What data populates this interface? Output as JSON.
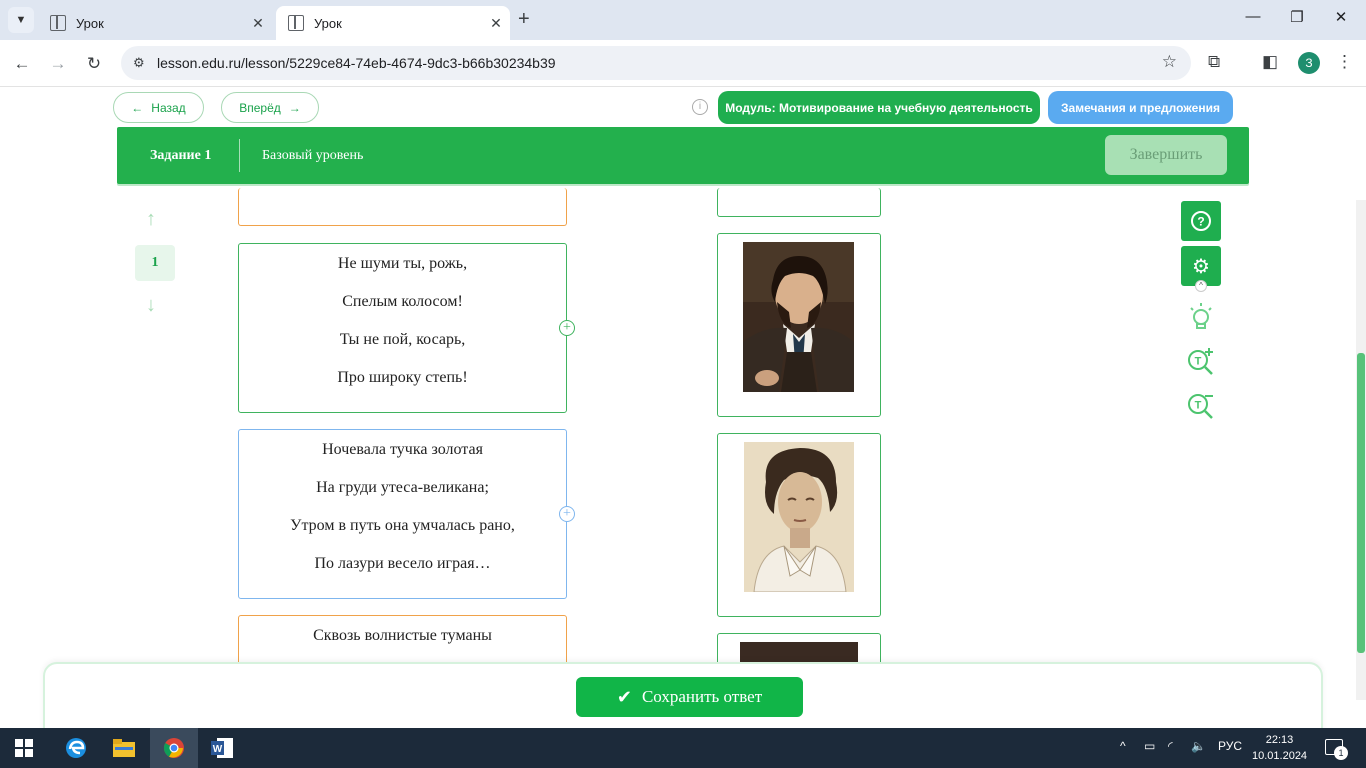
{
  "browser": {
    "tabs": [
      {
        "title": "Урок",
        "active": false
      },
      {
        "title": "Урок",
        "active": true
      }
    ],
    "url": "lesson.edu.ru/lesson/5229ce84-74eb-4674-9dc3-b66b30234b39",
    "profile_initial": "З"
  },
  "lesson_nav": {
    "back_label": "Назад",
    "forward_label": "Вперёд",
    "module_label": "Модуль: Мотивирование на учебную деятельность",
    "feedback_label": "Замечания и предложения"
  },
  "task_header": {
    "task_label": "Задание 1",
    "level_label": "Базовый уровень",
    "finish_label": "Завершить"
  },
  "pager": {
    "current": "1"
  },
  "poems": [
    {
      "lines": [
        "Не шуми ты, рожь,",
        "Спелым колосом!",
        "Ты не пой, косарь,",
        "Про широку степь!"
      ]
    },
    {
      "lines": [
        "Ночевала тучка золотая",
        "На груди утеса-великана;",
        "Утром в путь она умчалась рано,",
        "По лазури весело играя…"
      ]
    },
    {
      "lines": [
        "Сквозь волнистые туманы"
      ]
    }
  ],
  "portraits": [
    "portrait-pushkin",
    "portrait-blok",
    "portrait-third"
  ],
  "footer": {
    "save_label": "Сохранить ответ"
  },
  "taskbar": {
    "lang": "РУС",
    "time": "22:13",
    "date": "10.01.2024",
    "notifications": "1"
  },
  "colors": {
    "primary_green": "#1fae4f",
    "blue": "#5aaaf0",
    "orange_border": "#f0a24a"
  }
}
